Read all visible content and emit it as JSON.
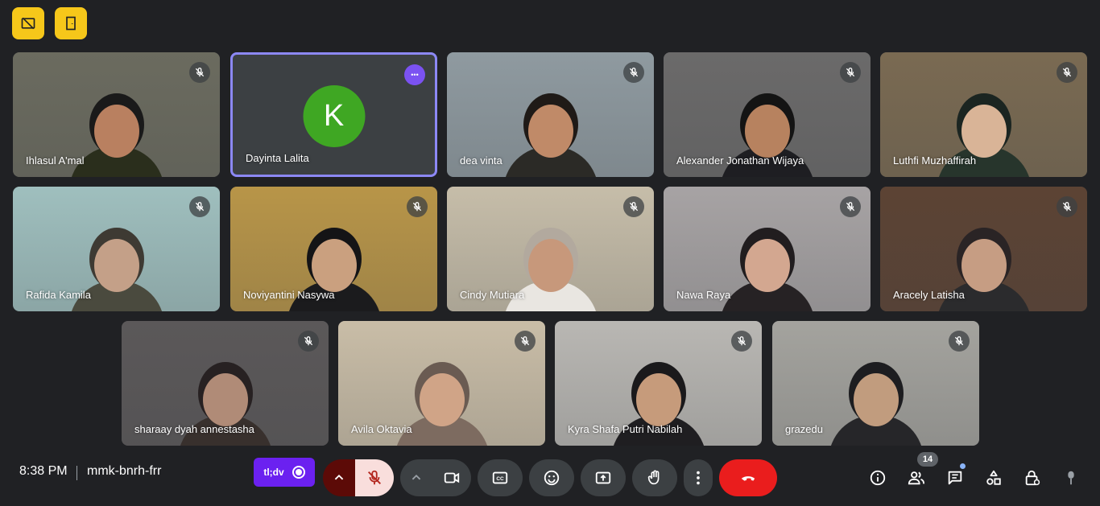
{
  "meeting": {
    "time": "8:38 PM",
    "code": "mmk-bnrh-frr",
    "participant_count": "14"
  },
  "tldv": {
    "label": "tl;dv"
  },
  "tiles": [
    {
      "name": "Ihlasul A'mal",
      "muted": true,
      "bg": "#6b6b5f",
      "skin": "#b98060",
      "cloth": "#2a2e1c",
      "hair": "#1a1a1a"
    },
    {
      "name": "Dayinta Lalita",
      "muted": false,
      "initial": "K",
      "active": true
    },
    {
      "name": "dea vinta",
      "muted": true,
      "bg": "#8f9aa0",
      "skin": "#c08a68",
      "cloth": "#2b2a26",
      "hair": "#1f1a17"
    },
    {
      "name": "Alexander Jonathan Wijaya",
      "muted": true,
      "bg": "#6b6a6a",
      "skin": "#b7825f",
      "cloth": "#1e1e22",
      "hair": "#141414"
    },
    {
      "name": "Luthfi Muzhaffirah",
      "muted": true,
      "bg": "#7a6a52",
      "skin": "#d9b497",
      "cloth": "#27352c",
      "hair": "#1b2521"
    },
    {
      "name": "Rafida Kamila",
      "muted": true,
      "bg": "#9fbfbe",
      "skin": "#c4a088",
      "cloth": "#4a4a3e",
      "hair": "#3e3a33"
    },
    {
      "name": "Noviyantini Nasywa",
      "muted": true,
      "bg": "#b89548",
      "skin": "#caa07f",
      "cloth": "#1b1b1d",
      "hair": "#141416"
    },
    {
      "name": "Cindy Mutiara",
      "muted": true,
      "bg": "#c6bda9",
      "skin": "#c7987b",
      "cloth": "#e9e6e1",
      "hair": "#b2a99e"
    },
    {
      "name": "Nawa Raya",
      "muted": true,
      "bg": "#a7a3a4",
      "skin": "#d3a790",
      "cloth": "#262224",
      "hair": "#211d1f"
    },
    {
      "name": "Aracely Latisha",
      "muted": true,
      "bg": "#5c4334",
      "skin": "#c69d83",
      "cloth": "#2b2b2d",
      "hair": "#2a2425"
    },
    {
      "name": "sharaay dyah annestasha",
      "muted": true,
      "bg": "#5b5859",
      "skin": "#b08b77",
      "cloth": "#38302d",
      "hair": "#272122"
    },
    {
      "name": "Avila Oktavia",
      "muted": true,
      "bg": "#c9bda7",
      "skin": "#d0a487",
      "cloth": "#7d6b60",
      "hair": "#6a5b52"
    },
    {
      "name": "Kyra Shafa Putri Nabilah",
      "muted": true,
      "bg": "#b9b7b3",
      "skin": "#c69b7b",
      "cloth": "#1f1e21",
      "hair": "#1a191b"
    },
    {
      "name": "grazedu",
      "muted": true,
      "bg": "#a4a39e",
      "skin": "#c19c7e",
      "cloth": "#262629",
      "hair": "#1d1d20"
    }
  ],
  "colors": {
    "accent": "#f6c71a",
    "end_call": "#ea4335",
    "tldv": "#6b21f0",
    "avatar": "#3fa723"
  },
  "icons": [
    "hide-self-view-icon",
    "door-icon",
    "mic-off-icon",
    "camera-icon",
    "captions-icon",
    "emoji-icon",
    "present-icon",
    "raise-hand-icon",
    "more-options-icon",
    "end-call-icon",
    "info-icon",
    "people-icon",
    "chat-icon",
    "activities-icon",
    "host-controls-icon",
    "cursor-icon"
  ]
}
